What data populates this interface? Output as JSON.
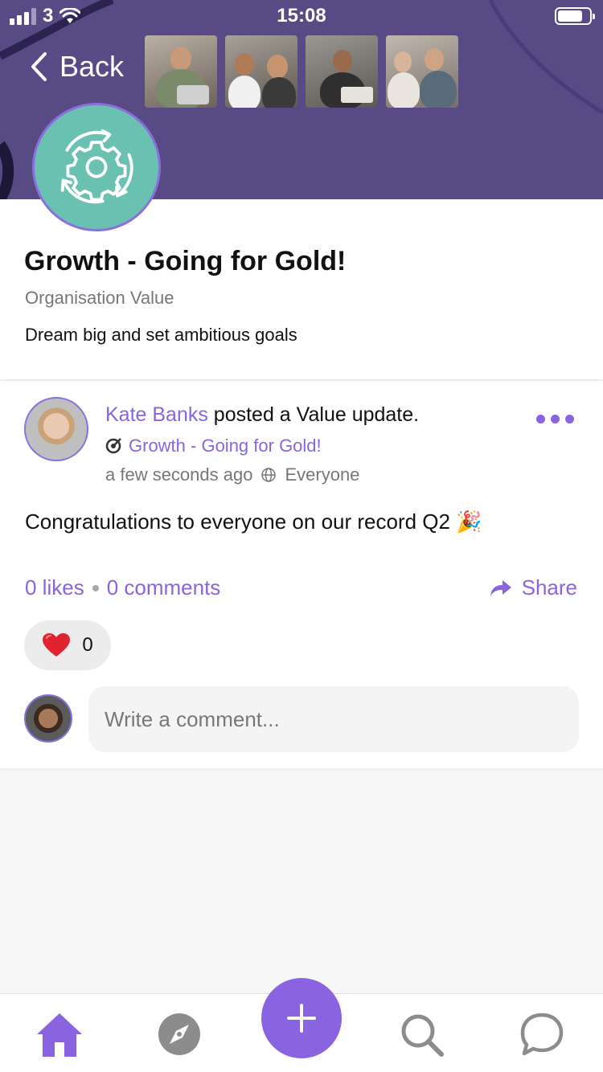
{
  "status_bar": {
    "carrier": "3",
    "time": "15:08"
  },
  "header": {
    "back_label": "Back",
    "accent_color": "#574a85",
    "thumbnails": [
      "team-photo-1",
      "team-photo-2",
      "team-photo-3",
      "team-photo-4"
    ]
  },
  "value": {
    "title": "Growth - Going for Gold!",
    "type": "Organisation Value",
    "description": "Dream big and set ambitious goals",
    "icon": "gear-cycle-icon",
    "icon_bg": "#6ac1b1"
  },
  "post": {
    "author": "Kate Banks",
    "action": " posted a Value update.",
    "value_link": "Growth - Going for Gold!",
    "time": "a few seconds ago",
    "audience": "Everyone",
    "body": "Congratulations to everyone on our record Q2 ",
    "emoji": "🎉",
    "likes": "0 likes",
    "comments": "0 comments",
    "share_label": "Share",
    "reaction_count": "0",
    "comment_placeholder": "Write a comment..."
  },
  "tabs": [
    {
      "name": "home",
      "active": true
    },
    {
      "name": "explore",
      "active": false
    },
    {
      "name": "create",
      "active": false
    },
    {
      "name": "search",
      "active": false
    },
    {
      "name": "messages",
      "active": false
    }
  ],
  "colors": {
    "accent": "#8a63e0",
    "inactive_icon": "#8c8c8c"
  }
}
